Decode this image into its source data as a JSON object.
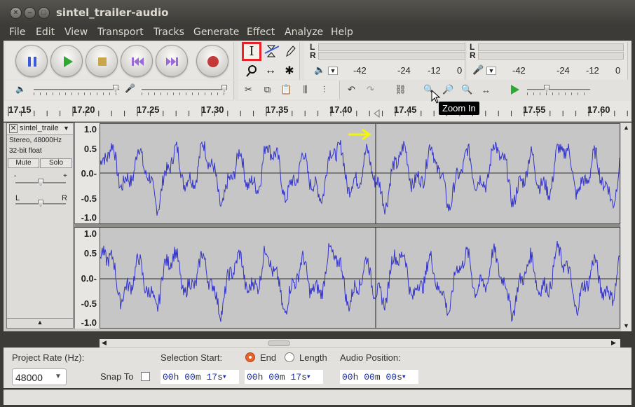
{
  "window": {
    "title": "sintel_trailer-audio",
    "close_glyph": "×",
    "min_glyph": "–",
    "max_glyph": "□"
  },
  "menubar": [
    "File",
    "Edit",
    "View",
    "Transport",
    "Tracks",
    "Generate",
    "Effect",
    "Analyze",
    "Help"
  ],
  "transport": [
    "pause-icon",
    "play-icon",
    "stop-icon",
    "skip-start-icon",
    "skip-end-icon",
    "record-icon"
  ],
  "tools": {
    "selection": "I",
    "envelope": "envelope-icon",
    "draw": "pencil-icon",
    "zoom": "magnifier-icon",
    "timeshift": "↔",
    "multi": "✱"
  },
  "meters": {
    "left_label": "L",
    "right_label": "R",
    "scale": [
      "-42",
      "-24",
      "-12",
      "0"
    ]
  },
  "ruler": {
    "labels": [
      "17.15",
      "17.20",
      "17.25",
      "17.30",
      "17.35",
      "17.40",
      "17.45",
      "17.55",
      "17.60"
    ]
  },
  "track": {
    "name": "sintel_traile",
    "info1": "Stereo, 48000Hz",
    "info2": "32-bit float",
    "mute": "Mute",
    "solo": "Solo",
    "gain_minus": "-",
    "gain_plus": "+",
    "pan_left": "L",
    "pan_right": "R",
    "axis": [
      "1.0",
      "0.5",
      "0.0-",
      "-0.5",
      "-1.0"
    ]
  },
  "tooltip": "Zoom In",
  "bottom": {
    "project_rate_label": "Project Rate (Hz):",
    "project_rate_value": "48000",
    "snap_to_label": "Snap To",
    "selection_start_label": "Selection Start:",
    "end_label": "End",
    "length_label": "Length",
    "audio_position_label": "Audio Position:",
    "selection_start": {
      "h": "00",
      "m": "00",
      "s": "17",
      "hu": "h",
      "mu": "m",
      "su": "s"
    },
    "selection_end": {
      "h": "00",
      "m": "00",
      "s": "17",
      "hu": "h",
      "mu": "m",
      "su": "s"
    },
    "audio_position": {
      "h": "00",
      "m": "00",
      "s": "00",
      "hu": "h",
      "mu": "m",
      "su": "s"
    }
  },
  "colors": {
    "waveform": "#3333cc",
    "selected_tool_border": "#e8212b",
    "annotation_arrow": "#f5f50a"
  }
}
